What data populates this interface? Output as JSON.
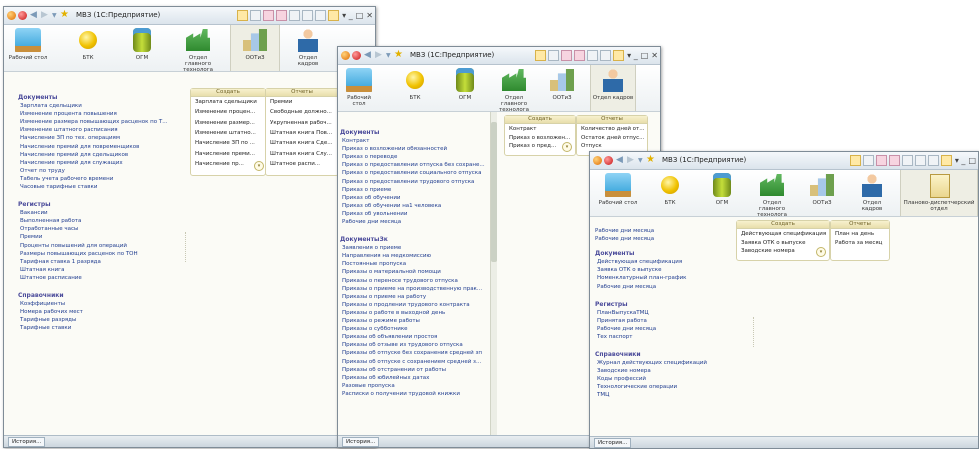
{
  "sections": [
    "Рабочий стол",
    "БТК",
    "ОГМ",
    "Отдел главного технолога",
    "ООТиЗ",
    "Отдел кадров",
    "Планово-диспетчерский отдел"
  ],
  "history_label": "История...",
  "window1": {
    "title": "МВЗ (1С:Предприятие)",
    "groups": [
      {
        "header": "Документы",
        "items": [
          "Зарплата сдельщики",
          "Изменение процента повышения",
          "Изменение размера повышающих расценок по Т...",
          "Изменение штатного расписания",
          "Начисление ЗП по тех. операциям",
          "Начисление премий для повременщиков",
          "Начисление премий для сдельщиков",
          "Начисление премий для служащих",
          "Отчет по труду",
          "Табель учета рабочего времени",
          "Часовые тарифные ставки"
        ]
      },
      {
        "header": "Регистры",
        "items": [
          "Вакансии",
          "Выполненная работа",
          "Отработанные часы",
          "Премии",
          "Проценты повышений для операций",
          "Размеры повышающих расценок по ТОН",
          "Тарифная ставка 1 разряда",
          "Штатная книга",
          "Штатное расписание"
        ]
      },
      {
        "header": "Справочники",
        "items": [
          "Коэффициенты",
          "Номера рабочих мест",
          "Тарифные разряды",
          "Тарифные ставки"
        ]
      }
    ],
    "create": {
      "header": "Создать",
      "items": [
        "Зарплата сдельщики",
        "Изменение процен...",
        "Изменение размер...",
        "Изменение штатно...",
        "Начисление ЗП по ...",
        "Начисление преми...",
        "Начисление пр..."
      ]
    },
    "reports": {
      "header": "Отчеты",
      "items": [
        "Премии",
        "Свободные должно...",
        "Укрупненная рабоч...",
        "Штатная книга Пов...",
        "Штатная книга Сде...",
        "Штатная книга Слу...",
        "Штатное распи..."
      ]
    }
  },
  "window2": {
    "title": "МВЗ (1С:Предприятие)",
    "groups": [
      {
        "header": "Документы",
        "items": [
          "Контракт",
          "Приказ о возложении обязанностей",
          "Приказ о переводе",
          "Приказ о предоставлении отпуска без сохране...",
          "Приказ о предоставлении социального отпуска",
          "Приказ о предоставлении трудового отпуска",
          "Приказ о приеме",
          "Приказ об обучении",
          "Приказ об обучении на1 человека",
          "Приказ об увольнении",
          "Рабочие дни месяца"
        ]
      },
      {
        "header": "ДокументыЗк",
        "items": [
          "Заявления о приеме",
          "Направления на медкомиссию",
          "Постоянные пропуска",
          "Приказы о материальной помощи",
          "Приказы о переносе трудового отпуска",
          "Приказы о приеме на производственную прак...",
          "Приказы о приеме на работу",
          "Приказы о продлении трудового контракта",
          "Приказы о работе в выходной день",
          "Приказы о режиме работы",
          "Приказы о субботнике",
          "Приказы об объявлении простоя",
          "Приказы об отзыве из трудового отпуска",
          "Приказы об отпуске без сохранения средней зп",
          "Приказы об отпуске с сохранением средней з...",
          "Приказы об отстранении от работы",
          "Приказы об юбилейных датах",
          "Разовые пропуска",
          "Расписки о получении трудовой книжки"
        ]
      }
    ],
    "create": {
      "header": "Создать",
      "items": [
        "Контракт",
        "Приказ о возложен...",
        "Приказ о пред..."
      ]
    },
    "reports": {
      "header": "Отчеты",
      "items": [
        "Количество дней от...",
        "Остаток дней отпус...",
        "Отпуск"
      ]
    }
  },
  "window3": {
    "title": "МВЗ (1С:Предприятие)",
    "top_items": [
      "Рабочие дни месяца",
      "Рабочие дни месяца"
    ],
    "groups": [
      {
        "header": "Документы",
        "items": [
          "Действующая спецификация",
          "Заявка ОТК о выпуске",
          "Номенклатурный план-график",
          "Рабочие дни месяца"
        ]
      },
      {
        "header": "Регистры",
        "items": [
          "ПланВыпускаТМЦ",
          "Принятая работа",
          "Рабочие дни месяца",
          "Тех паспорт"
        ]
      },
      {
        "header": "Справочники",
        "items": [
          "Журнал действующих спецификаций",
          "Заводские номера",
          "Коды профессий",
          "Технологические операции",
          "ТМЦ"
        ]
      }
    ],
    "create": {
      "header": "Создать",
      "items": [
        "Действующая спецификация",
        "Заявка ОТК о выпуске",
        "Заводские номера"
      ]
    },
    "reports": {
      "header": "Отчеты",
      "items": [
        "План на день",
        "Работа за месяц"
      ]
    }
  }
}
